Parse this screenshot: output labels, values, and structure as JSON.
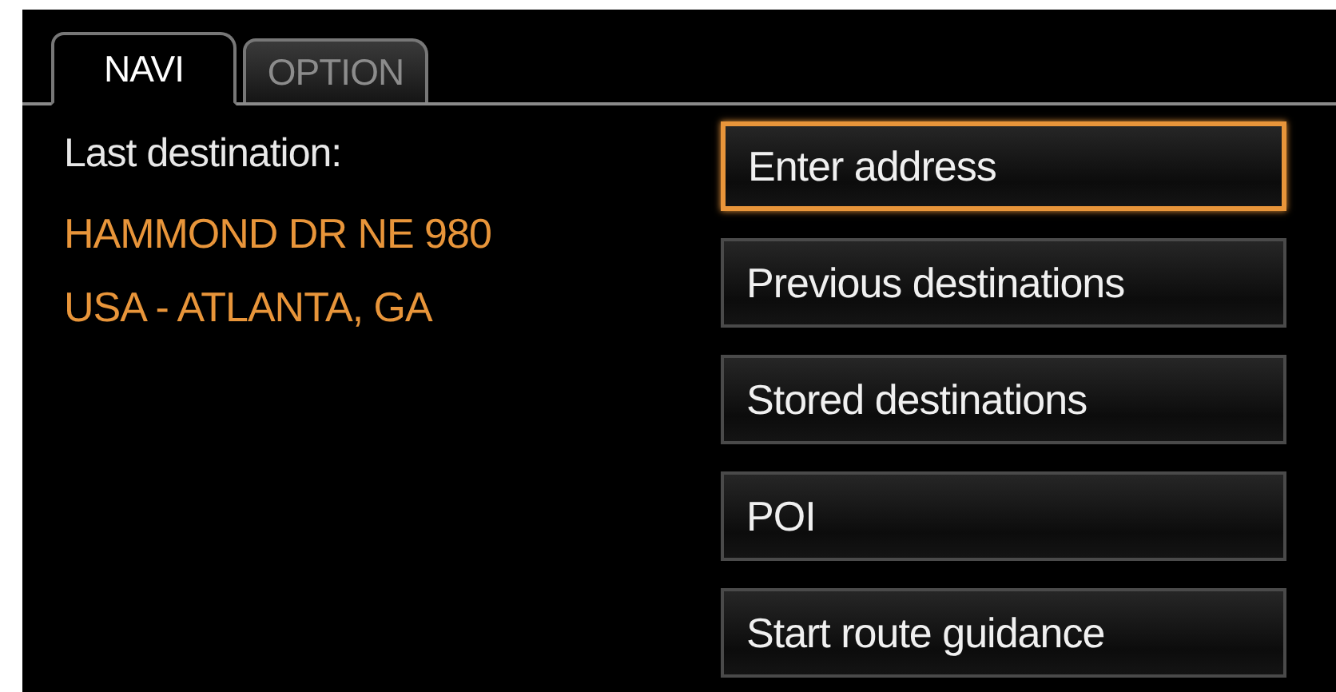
{
  "tabs": [
    {
      "label": "NAVI",
      "selected": true
    },
    {
      "label": "OPTION",
      "selected": false
    }
  ],
  "last_destination": {
    "label": "Last destination:",
    "lines": [
      "HAMMOND DR NE 980",
      "USA - ATLANTA, GA"
    ]
  },
  "menu": [
    {
      "label": "Enter address",
      "selected": true
    },
    {
      "label": "Previous destinations",
      "selected": false
    },
    {
      "label": "Stored destinations",
      "selected": false
    },
    {
      "label": "POI",
      "selected": false
    },
    {
      "label": "Start route guidance",
      "selected": false
    }
  ]
}
